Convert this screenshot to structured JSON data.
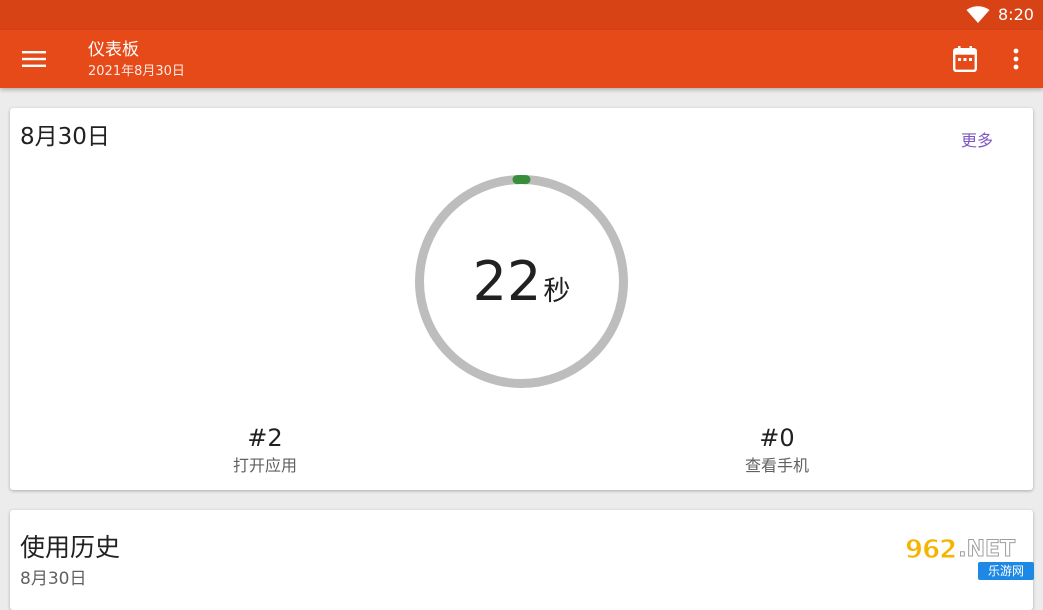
{
  "status_bar": {
    "time": "8:20",
    "icons": [
      "wifi-icon"
    ]
  },
  "app_bar": {
    "title": "仪表板",
    "subtitle": "2021年8月30日",
    "icons": [
      "menu-icon",
      "calendar-icon",
      "more-vert-icon"
    ]
  },
  "today_card": {
    "date_title": "8月30日",
    "more_label": "更多",
    "usage_value": "22",
    "usage_unit": "秒",
    "stats": [
      {
        "value": "#2",
        "label": "打开应用"
      },
      {
        "value": "#0",
        "label": "查看手机"
      }
    ]
  },
  "history_card": {
    "title": "使用历史",
    "date": "8月30日"
  },
  "watermark": {
    "brand_number": "962",
    "brand_suffix": ".NET",
    "brand_name": "乐游网"
  },
  "colors": {
    "status_bar": "#d84315",
    "app_bar": "#e64a19",
    "accent_link": "#7e57c2",
    "ring_track": "#bdbdbd",
    "ring_progress": "#388e3c",
    "background": "#ececec"
  }
}
